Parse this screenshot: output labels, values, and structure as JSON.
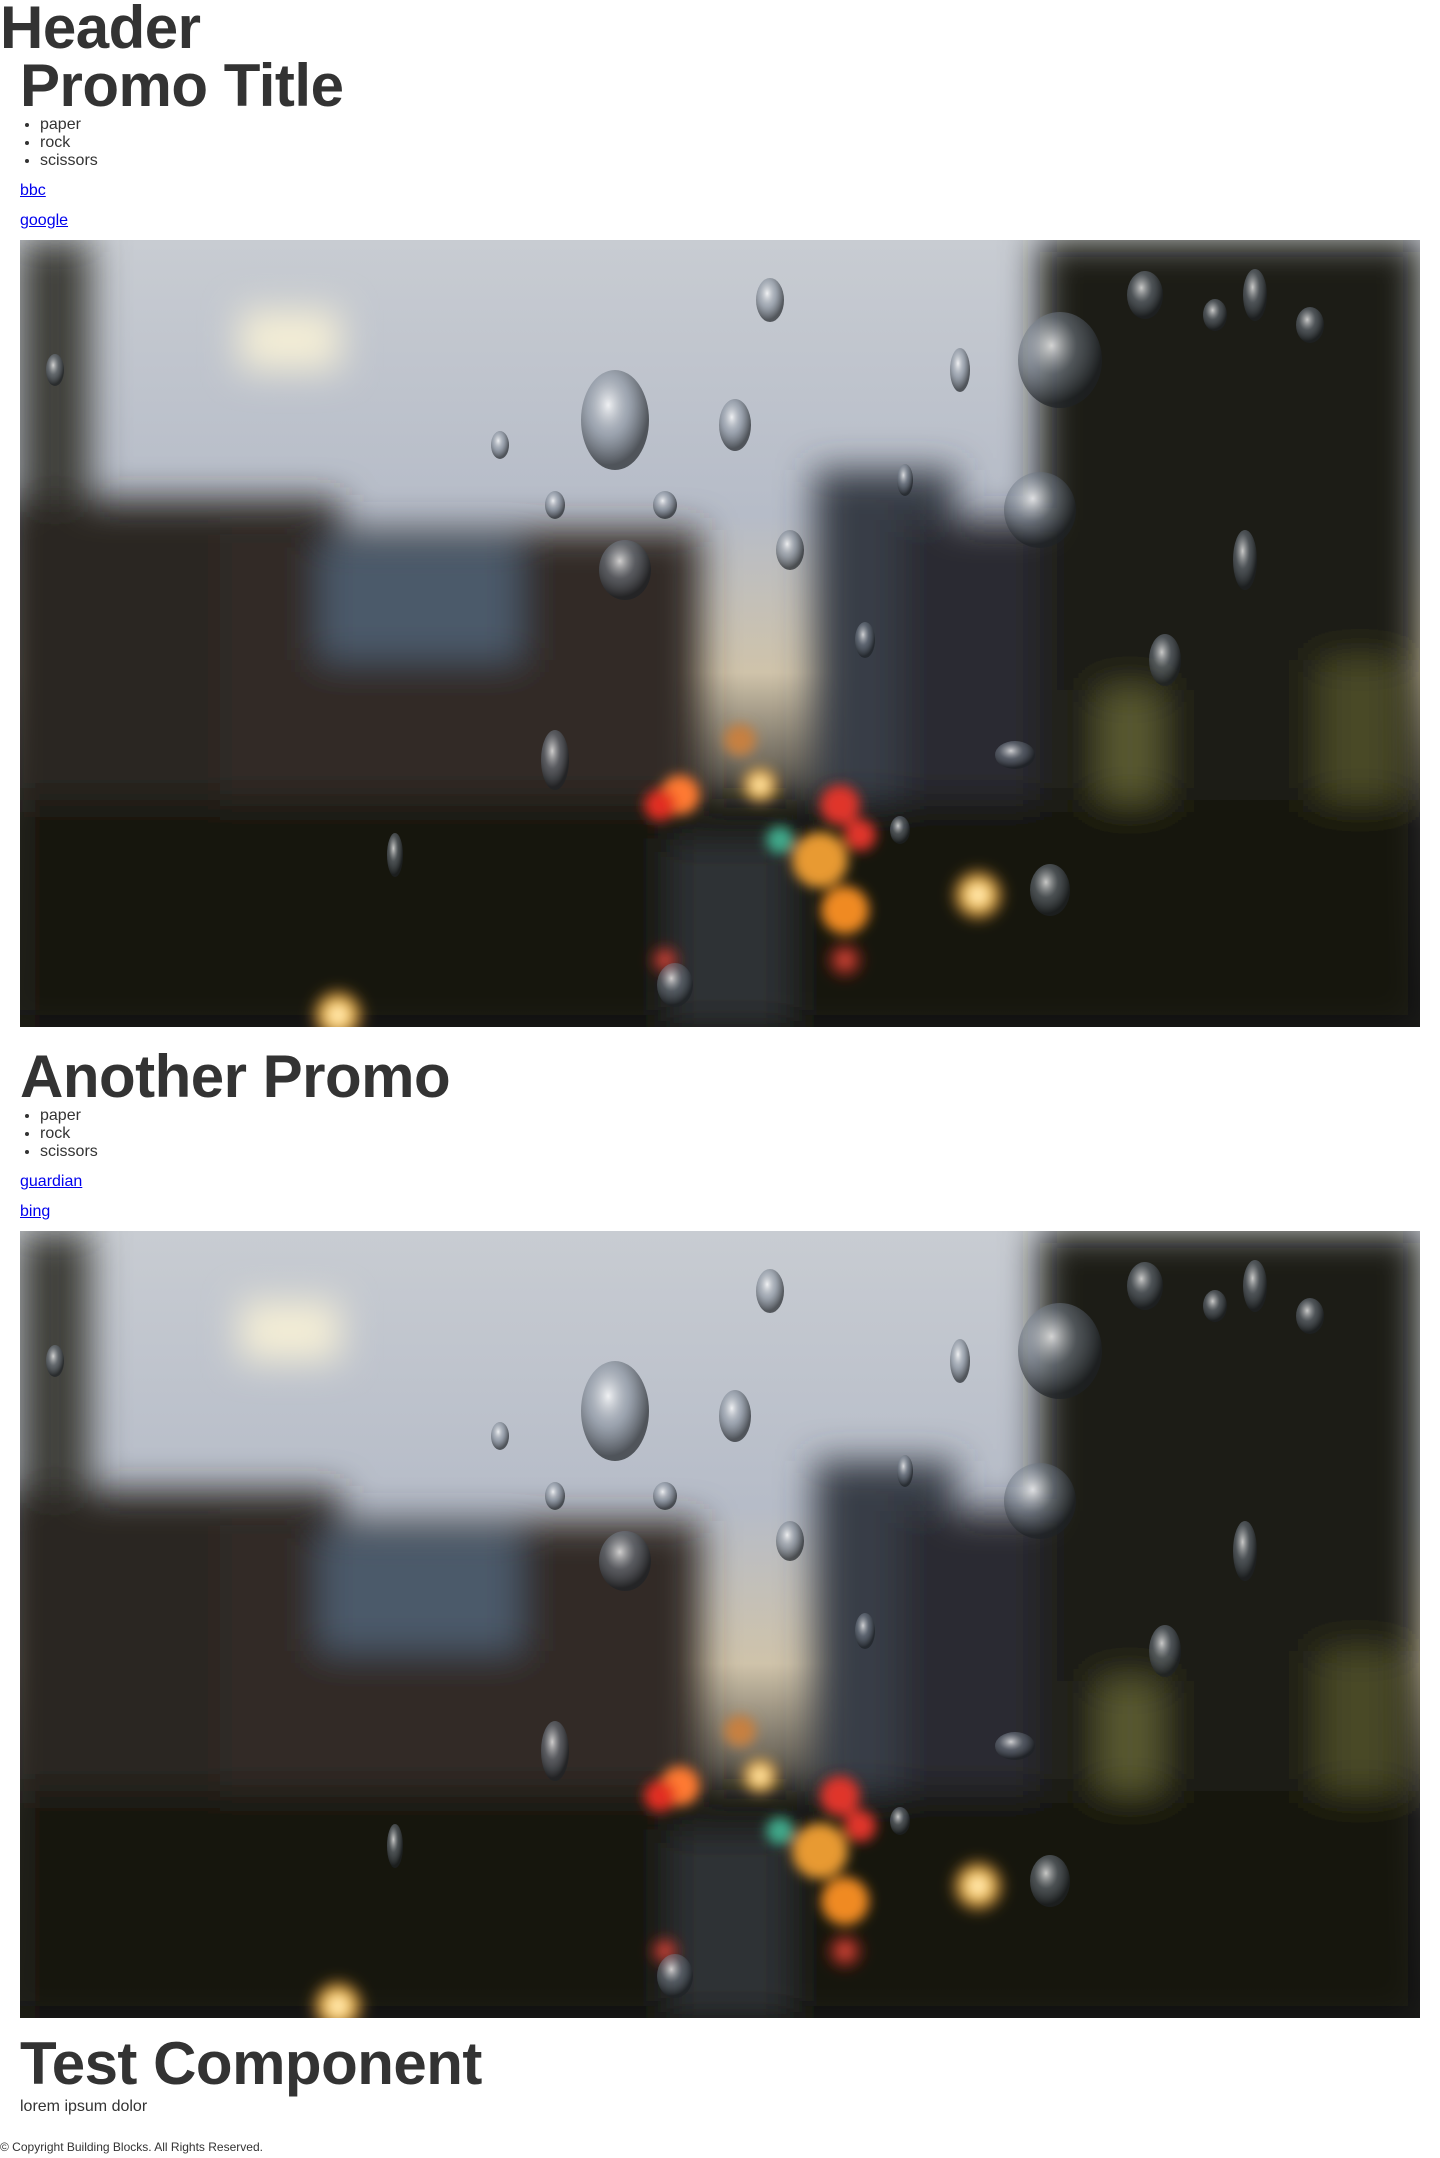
{
  "header": {
    "title": "Header"
  },
  "promos": [
    {
      "title": "Promo Title",
      "list": [
        "paper",
        "rock",
        "scissors"
      ],
      "links": [
        "bbc",
        "google"
      ],
      "image": {
        "description": "rain drops on window over blurred city street at dusk"
      }
    },
    {
      "title": "Another Promo",
      "list": [
        "paper",
        "rock",
        "scissors"
      ],
      "links": [
        "guardian",
        "bing"
      ],
      "image": {
        "description": "rain drops on window over blurred city street at dusk"
      }
    }
  ],
  "test_component": {
    "title": "Test Component",
    "text": "lorem ipsum dolor"
  },
  "footer": {
    "copyright": "© Copyright Building Blocks. All Rights Reserved."
  },
  "colors": {
    "text": "#333333",
    "link": "#0000ee",
    "background": "#ffffff"
  }
}
